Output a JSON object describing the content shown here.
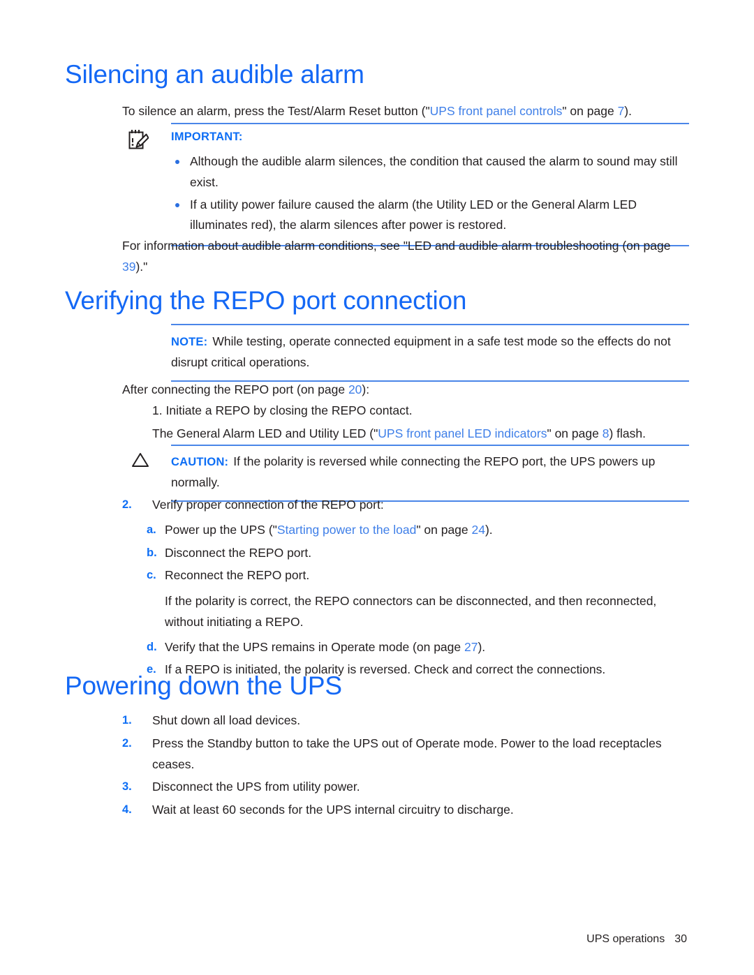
{
  "document": {
    "footer": {
      "chapter": "UPS operations",
      "page_number": "30"
    }
  },
  "sections": [
    {
      "id": "silencing-an-audible-alarm",
      "heading": "Silencing an audible alarm",
      "intro_pre": "To silence an alarm, press the Test/Alarm Reset button (\"",
      "intro_link": "UPS front panel controls",
      "intro_mid": "\" on page ",
      "intro_page": "7",
      "intro_post": ").",
      "important": {
        "label": "IMPORTANT:",
        "icon": "notepad-pencil-icon",
        "bullets": [
          "Although the audible alarm silences, the condition that caused the alarm to sound may still exist.",
          "If a utility power failure caused the alarm (the Utility LED or the General Alarm LED illuminates red), the alarm silences after power is restored."
        ]
      },
      "closing_pre": "For information about audible alarm conditions, see \"LED and audible alarm troubleshooting (on page ",
      "closing_page": "39",
      "closing_post": ").\""
    },
    {
      "id": "verifying-the-repo-port-connection",
      "heading": "Verifying the REPO port connection",
      "note": {
        "label": "NOTE:",
        "text": "While testing, operate connected equipment in a safe test mode so the effects do not disrupt critical operations."
      },
      "lead_pre": "After connecting the REPO port (on page ",
      "lead_page": "20",
      "lead_post": "):",
      "step1": {
        "marker": "1.",
        "text": "Initiate a REPO by closing the REPO contact.",
        "followup_pre": "The General Alarm LED and Utility LED (\"",
        "followup_link": "UPS front panel LED indicators",
        "followup_mid": "\" on page ",
        "followup_page": "8",
        "followup_post": ") flash."
      },
      "caution": {
        "label": "CAUTION:",
        "icon": "warning-triangle-icon",
        "text": "If the polarity is reversed while connecting the REPO port, the UPS powers up normally."
      },
      "step2": {
        "marker": "2.",
        "text": "Verify proper connection of the REPO port:",
        "substeps": [
          {
            "marker": "a.",
            "pre": "Power up the UPS (\"",
            "link": "Starting power to the load",
            "mid": "\" on page ",
            "page": "24",
            "post": ")."
          },
          {
            "marker": "b.",
            "pre": "Disconnect the REPO port.",
            "link": "",
            "mid": "",
            "page": "",
            "post": ""
          },
          {
            "marker": "c.",
            "pre": "Reconnect the REPO port.",
            "link": "",
            "mid": "",
            "page": "",
            "post": ""
          }
        ],
        "substep_c_followup": "If the polarity is correct, the REPO connectors can be disconnected, and then reconnected, without initiating a REPO.",
        "substeps_tail": [
          {
            "marker": "d.",
            "pre": "Verify that the UPS remains in Operate mode (on page ",
            "link": "",
            "mid": "",
            "page": "27",
            "post": ")."
          },
          {
            "marker": "e.",
            "pre": "If a REPO is initiated, the polarity is reversed. Check and correct the connections.",
            "link": "",
            "mid": "",
            "page": "",
            "post": ""
          }
        ]
      }
    },
    {
      "id": "powering-down-the-ups",
      "heading": "Powering down the UPS",
      "steps": [
        {
          "marker": "1.",
          "text": "Shut down all load devices."
        },
        {
          "marker": "2.",
          "text": "Press the Standby button to take the UPS out of Operate mode. Power to the load receptacles ceases."
        },
        {
          "marker": "3.",
          "text": "Disconnect the UPS from utility power."
        },
        {
          "marker": "4.",
          "text": "Wait at least 60 seconds for the UPS internal circuitry to discharge."
        }
      ]
    }
  ],
  "colors": {
    "heading_blue": "#1468f5",
    "link_blue": "#3f7fe8",
    "rule_blue": "#4a86e8",
    "label_blue": "#0d6ef5",
    "body_black": "#231f20"
  }
}
